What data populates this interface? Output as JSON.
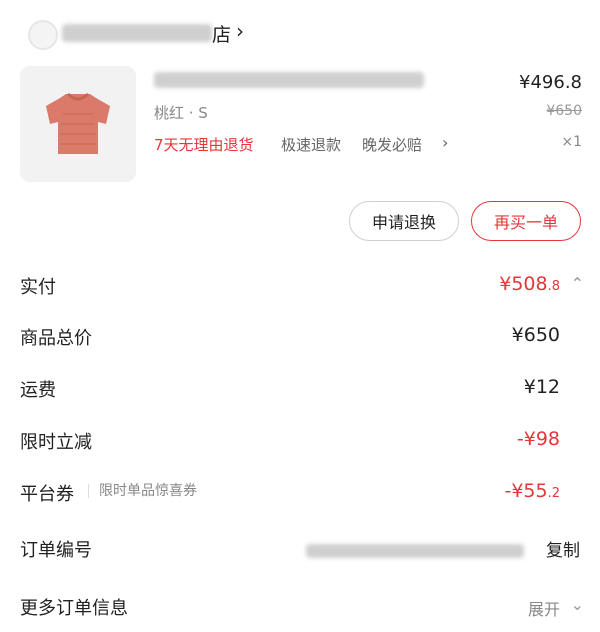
{
  "shop": {
    "name_suffix": "店",
    "chevron": "›"
  },
  "product": {
    "variant": "桃红 · S",
    "tags": {
      "return": "7天无理由退货",
      "refund": "极速退款",
      "late": "晚发必赔",
      "chevron": "›"
    },
    "price": "¥496.8",
    "original_price": "¥650",
    "quantity": "×1"
  },
  "buttons": {
    "return": "申请退换",
    "rebuy": "再买一单"
  },
  "summary": {
    "paid": {
      "label": "实付",
      "value_main": "¥508",
      "value_dec": ".8"
    },
    "goods_total": {
      "label": "商品总价",
      "value": "¥650"
    },
    "shipping": {
      "label": "运费",
      "value": "¥12"
    },
    "discount": {
      "label": "限时立减",
      "value": "-¥98"
    },
    "coupon": {
      "label": "平台券",
      "sub": "限时单品惊喜券",
      "value_main": "-¥55",
      "value_dec": ".2"
    },
    "order_no": {
      "label": "订单编号",
      "action": "复制"
    },
    "more": {
      "label": "更多订单信息",
      "action": "展开"
    }
  },
  "colors": {
    "accent": "#e5363a",
    "product": "#d97a6a"
  },
  "icons": {
    "paid_toggle": "chevron-up-icon",
    "more_toggle": "chevron-down-icon"
  }
}
